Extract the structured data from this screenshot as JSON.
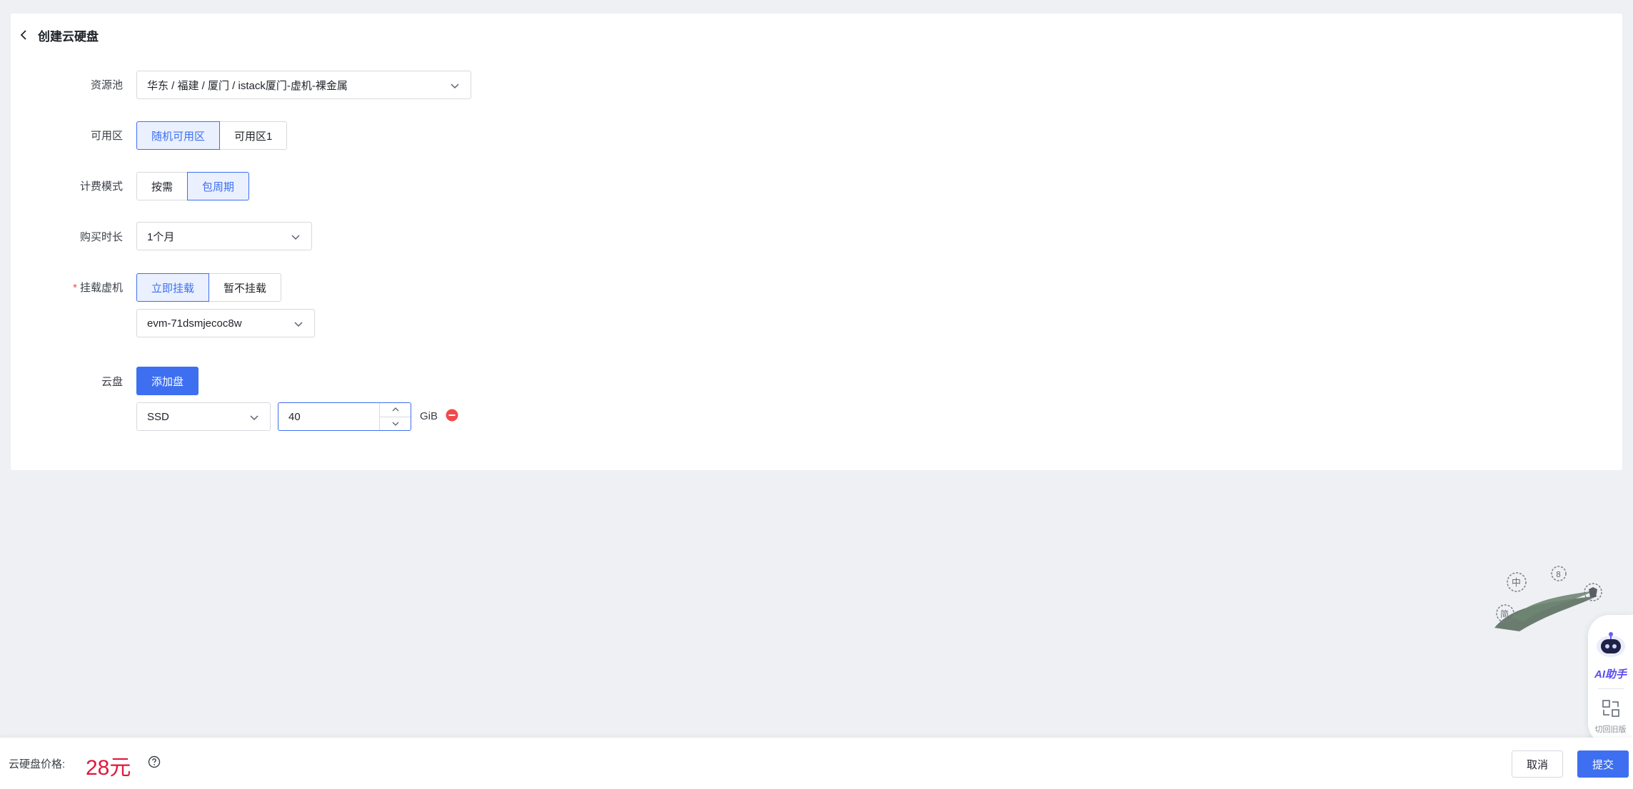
{
  "page": {
    "title": "创建云硬盘"
  },
  "form": {
    "resource_pool": {
      "label": "资源池",
      "value": "华东 / 福建 / 厦门 / istack厦门-虚机-裸金属"
    },
    "zone": {
      "label": "可用区",
      "options": [
        "随机可用区",
        "可用区1"
      ],
      "selected": "随机可用区"
    },
    "billing": {
      "label": "计费模式",
      "options": [
        "按需",
        "包周期"
      ],
      "selected": "包周期"
    },
    "duration": {
      "label": "购买时长",
      "value": "1个月"
    },
    "mount": {
      "required_mark": "*",
      "label": "挂载虚机",
      "options": [
        "立即挂载",
        "暂不挂载"
      ],
      "selected": "立即挂载",
      "vm_value": "evm-71dsmjecoc8w"
    },
    "disk": {
      "label": "云盘",
      "add_button": "添加盘",
      "type_value": "SSD",
      "size_value": "40",
      "unit": "GiB"
    }
  },
  "footer": {
    "price_label": "云硬盘价格:",
    "price_value": "28元",
    "cancel_label": "取消",
    "submit_label": "提交"
  },
  "side_panel": {
    "ai_label": "AI助手",
    "switch_label": "切回旧版"
  },
  "colors": {
    "primary": "#3d6ff0",
    "price": "#e0183c",
    "danger": "#f04b4b"
  }
}
